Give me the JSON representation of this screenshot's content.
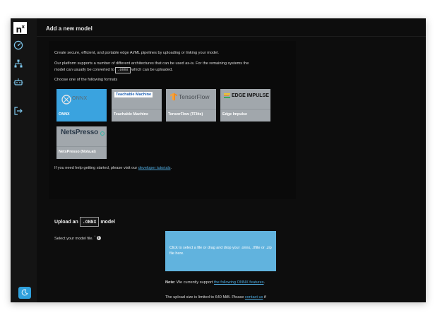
{
  "app": {
    "logo_text": "n",
    "logo_sup": "x"
  },
  "header": {
    "title": "Add a new model"
  },
  "sidebar": {
    "items": [
      {
        "icon": "dashboard-gauge-icon",
        "label": "Dashboard"
      },
      {
        "icon": "sitemap-icon",
        "label": "Models"
      },
      {
        "icon": "robot-icon",
        "label": "Devices"
      },
      {
        "icon": "logout-icon",
        "label": "Log out"
      }
    ],
    "theme_toggle_icon": "moon-icon",
    "accent": "#2fa0dc"
  },
  "intro": {
    "line1": "Create secure, efficient, and portable edge AI/ML pipelines by uploading or linking your model.",
    "line2a": "Our platform supports a number of different architectures that can be used as-is. For the remaining systems the",
    "line2b_pre": "model can usually be converted to",
    "line2b_code": ".onnx",
    "line2b_post": "which can be uploaded.",
    "choose": "Choose one of the following formats"
  },
  "formats": [
    {
      "logo": "ONNX",
      "label": "ONNX",
      "selected": true
    },
    {
      "logo": "Teachable Machine",
      "label": "Teachable Machine",
      "selected": false
    },
    {
      "logo": "TensorFlow",
      "label": "TensorFlow (TFlite)",
      "selected": false
    },
    {
      "logo": "EDGE IMPULSE",
      "label": "Edge Impulse",
      "selected": false
    },
    {
      "logo": "NetsPresso",
      "label": "NetsPresso (Nota.ai)",
      "selected": false
    }
  ],
  "help": {
    "pre": "If you need help getting started, please visit our",
    "link": "developer tutorials",
    "post": "."
  },
  "upload": {
    "title_pre": "Upload an",
    "title_code": ".ONNX",
    "title_post": "model",
    "select_label": "Select your model file.",
    "required_mark": "*",
    "info_glyph": "i",
    "dropzone_text": "Click to select a file or drag and drop your .onnx, .tflite or .zip file here.",
    "note_label": "Note:",
    "note_pre": "We currently support",
    "note_link": "the following ONNX features",
    "note_post": ".",
    "limit_pre": "The upload size is limited to 640 MiB. Please",
    "limit_link": "contact us",
    "limit_post": "if"
  },
  "colors": {
    "selected_tile": "#3aa3df",
    "tile": "#a1a7ac",
    "dropzone": "#61b3de",
    "background": "#0d0d0d"
  }
}
